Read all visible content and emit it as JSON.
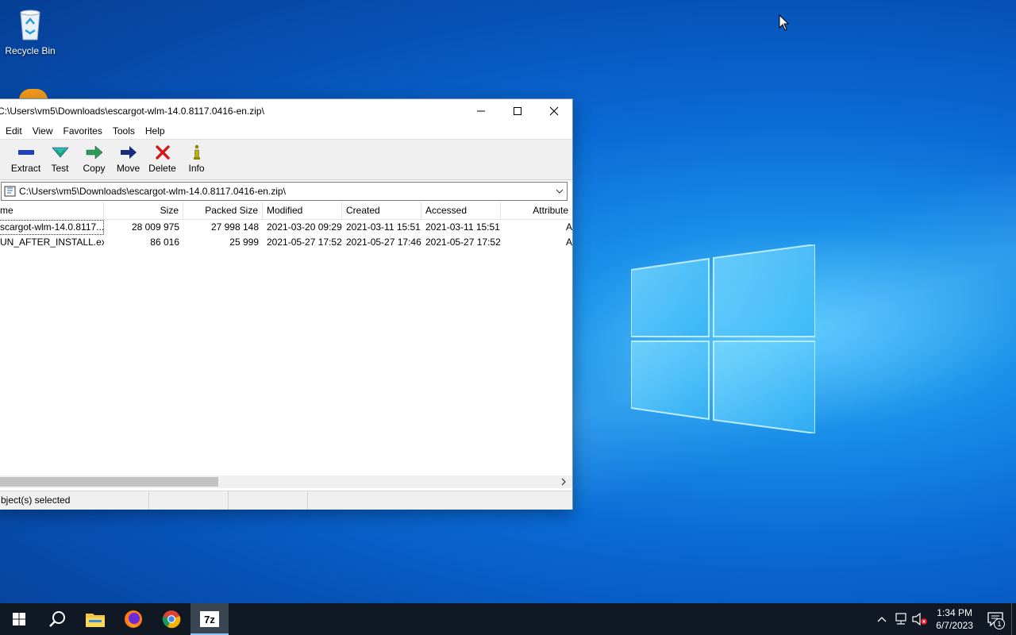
{
  "desktop": {
    "recycle_bin_label": "Recycle Bin"
  },
  "window": {
    "title": "C:\\Users\\vm5\\Downloads\\escargot-wlm-14.0.8117.0416-en.zip\\",
    "menu": [
      "Edit",
      "View",
      "Favorites",
      "Tools",
      "Help"
    ],
    "toolbar": [
      {
        "label": "Extract",
        "icon": "extract-icon"
      },
      {
        "label": "Test",
        "icon": "test-icon"
      },
      {
        "label": "Copy",
        "icon": "copy-icon"
      },
      {
        "label": "Move",
        "icon": "move-icon"
      },
      {
        "label": "Delete",
        "icon": "delete-icon"
      },
      {
        "label": "Info",
        "icon": "info-icon"
      }
    ],
    "address": "C:\\Users\\vm5\\Downloads\\escargot-wlm-14.0.8117.0416-en.zip\\",
    "columns": [
      "me",
      "Size",
      "Packed Size",
      "Modified",
      "Created",
      "Accessed",
      "Attribute"
    ],
    "rows": [
      {
        "name": "scargot-wlm-14.0.8117...",
        "size": "28 009 975",
        "packed": "27 998 148",
        "modified": "2021-03-20 09:29",
        "created": "2021-03-11 15:51",
        "accessed": "2021-03-11 15:51",
        "attr": "A"
      },
      {
        "name": "UN_AFTER_INSTALL.exe",
        "size": "86 016",
        "packed": "25 999",
        "modified": "2021-05-27 17:52",
        "created": "2021-05-27 17:46",
        "accessed": "2021-05-27 17:52",
        "attr": "A"
      }
    ],
    "status": "bject(s) selected"
  },
  "taskbar": {
    "time": "1:34 PM",
    "date": "6/7/2023",
    "notification_count": "1",
    "apps": [
      "start-icon",
      "search-icon",
      "file-explorer-icon",
      "firefox-icon",
      "chrome-icon",
      "7zip-icon"
    ],
    "active_app": "7z"
  },
  "colors": {
    "taskbar_bg": "#101923",
    "extract_blue": "#1f3fbf",
    "test_teal": "#2fb8b0",
    "copy_green": "#2d9a55",
    "move_navy": "#1b2a7a",
    "delete_red": "#d11a1a",
    "info_olive": "#8a8a00"
  }
}
